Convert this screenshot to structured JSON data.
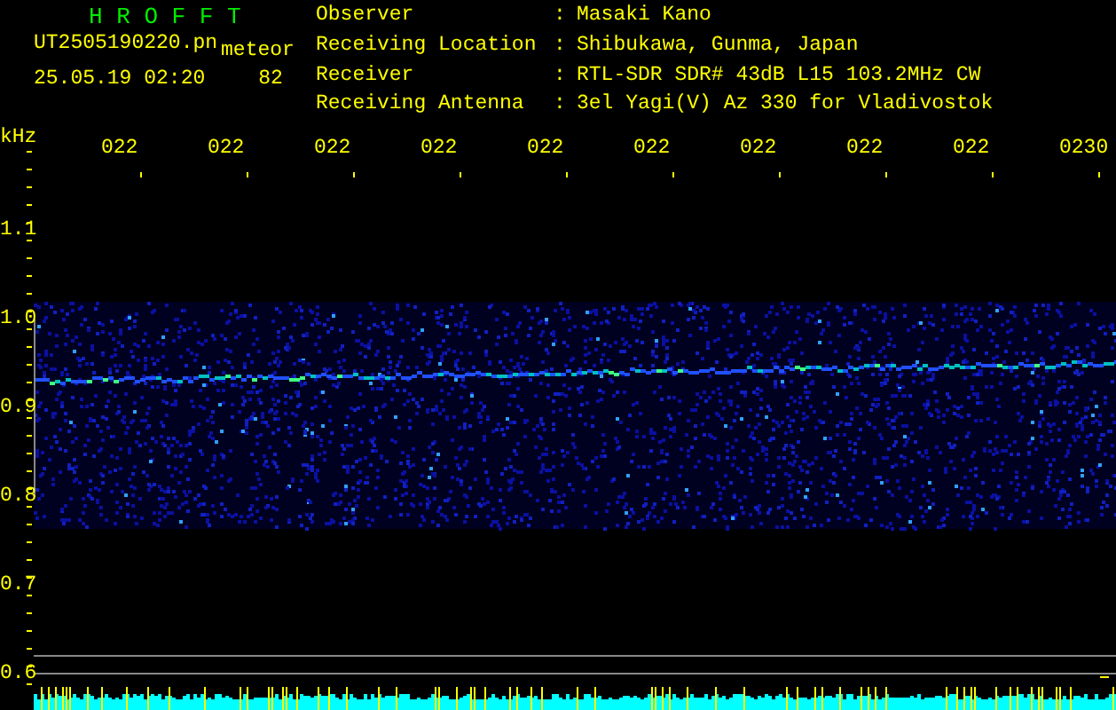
{
  "header": {
    "title": "H R O F F T",
    "filename": "UT2505190220.pn",
    "mode": "meteor",
    "datetime": "25.05.19 02:20",
    "count": "82"
  },
  "info": [
    {
      "label": "Observer",
      "separator": ":",
      "value": "Masaki Kano"
    },
    {
      "label": "Receiving Location",
      "separator": ":",
      "value": "Shibukawa, Gunma, Japan"
    },
    {
      "label": "Receiver",
      "separator": ":",
      "value": "RTL-SDR SDR# 43dB L15 103.2MHz CW"
    },
    {
      "label": "Receiving Antenna",
      "separator": ":",
      "value": "3el Yagi(V) Az 330 for Vladivostok"
    }
  ],
  "plot": {
    "unit": "kHz",
    "time_labels": [
      "022",
      "022",
      "022",
      "022",
      "022",
      "022",
      "022",
      "022",
      "022",
      "0230"
    ],
    "freq_labels": [
      "1.1",
      "1.0",
      "0.9",
      "0.8",
      "0.7",
      "0.6"
    ]
  }
}
